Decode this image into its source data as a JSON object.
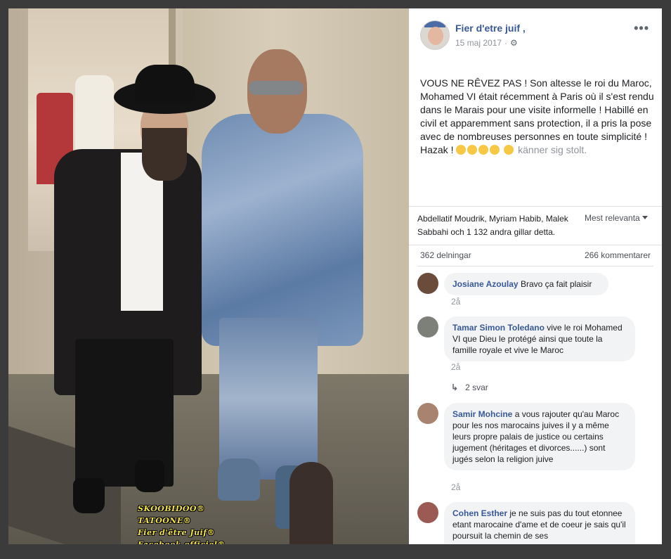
{
  "post": {
    "author": "Fier d'etre juif ,",
    "date": "15 maj 2017",
    "text_main": "VOUS NE RÊVEZ PAS ! Son altesse le roi du Maroc, Mohamed VI était récemment à Paris où il s'est rendu dans le Marais pour une visite informelle ! Habillé en civil et apparemment sans protection, il a pris la pose avec de nombreuses personnes en toute simplicité ! Hazak !",
    "text_tail": "känner sig stolt."
  },
  "photo": {
    "watermark": [
      "SKOOBIDOO®",
      "TATOONE®",
      "Fier d'être Juif®",
      "Facebook officiel®"
    ]
  },
  "reactions": {
    "likes_text": "Abdellatif Moudrik, Myriam Habib, Malek Sabbahi och 1 132 andra gillar detta.",
    "sort_label": "Mest relevanta",
    "shares": "362 delningar",
    "comments": "266 kommentarer"
  },
  "comments": [
    {
      "name": "Josiane Azoulay",
      "text": "Bravo ça fait plaisir",
      "time": "2å"
    },
    {
      "name": "Tamar Simon Toledano",
      "text": "vive le roi Mohamed VI que Dieu le protégé ainsi que toute la famille royale et vive le Maroc",
      "time": "2å",
      "replies": "2 svar"
    },
    {
      "name": "Samir Mohcine",
      "text": "a vous rajouter qu'au Maroc pour les nos marocains juives il y a même leurs propre palais de justice ou certains jugement (héritages et divorces......) sont jugés selon la religion juive",
      "time": "2å"
    },
    {
      "name": "Cohen Esther",
      "text": "je ne suis pas du tout etonnee etant marocaine d'ame et de coeur je sais qu'il poursuit la chemin de ses"
    }
  ],
  "icons": {
    "more": "more-options-icon",
    "privacy": "gear-icon",
    "reply": "reply-arrow-icon",
    "dropdown": "caret-down-icon"
  },
  "colors": {
    "link": "#385898",
    "muted": "#90949c",
    "bubble": "#f2f3f5",
    "watermark": "#f3e34a"
  }
}
